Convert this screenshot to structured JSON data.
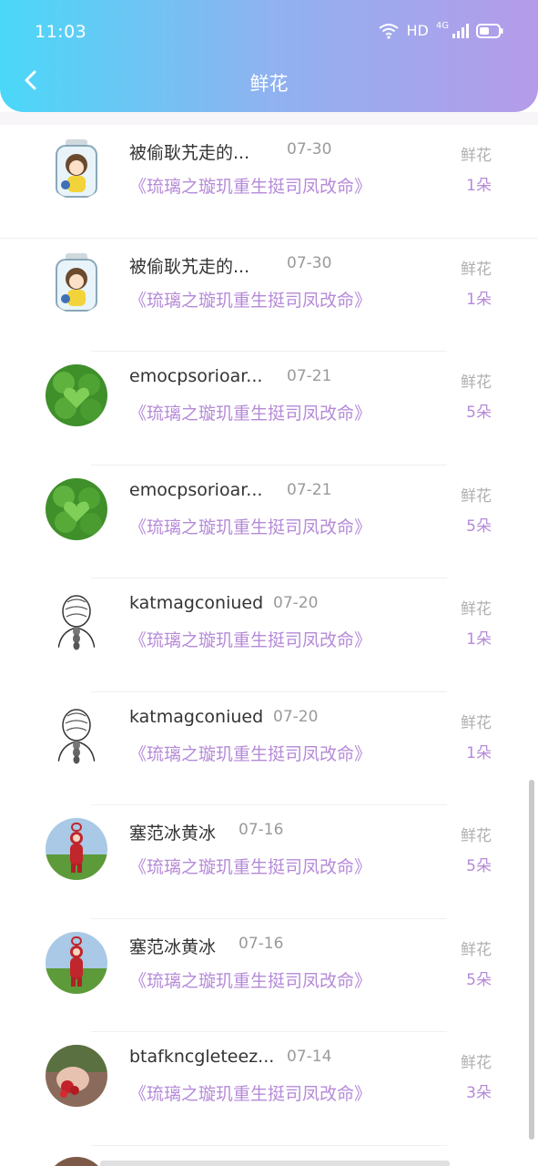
{
  "status_bar": {
    "time": "11:03",
    "hd": "HD",
    "network": "4G"
  },
  "header": {
    "title": "鲜花"
  },
  "records": [
    {
      "name": "被偷耿艽走的...",
      "date": "07-30",
      "book": "《琉璃之璇玑重生挺司凤改命》",
      "type": "鲜花",
      "count": "1朵"
    },
    {
      "name": "被偷耿艽走的...",
      "date": "07-30",
      "book": "《琉璃之璇玑重生挺司凤改命》",
      "type": "鲜花",
      "count": "1朵"
    },
    {
      "name": "emocpsorioar...",
      "date": "07-21",
      "book": "《琉璃之璇玑重生挺司凤改命》",
      "type": "鲜花",
      "count": "5朵"
    },
    {
      "name": "emocpsorioar...",
      "date": "07-21",
      "book": "《琉璃之璇玑重生挺司凤改命》",
      "type": "鲜花",
      "count": "5朵"
    },
    {
      "name": "katmagconiued",
      "date": "07-20",
      "book": "《琉璃之璇玑重生挺司凤改命》",
      "type": "鲜花",
      "count": "1朵"
    },
    {
      "name": "katmagconiued",
      "date": "07-20",
      "book": "《琉璃之璇玑重生挺司凤改命》",
      "type": "鲜花",
      "count": "1朵"
    },
    {
      "name": "塞范冰黄冰",
      "date": "07-16",
      "book": "《琉璃之璇玑重生挺司凤改命》",
      "type": "鲜花",
      "count": "5朵"
    },
    {
      "name": "塞范冰黄冰",
      "date": "07-16",
      "book": "《琉璃之璇玑重生挺司凤改命》",
      "type": "鲜花",
      "count": "5朵"
    },
    {
      "name": "btafkncgleteez...",
      "date": "07-14",
      "book": "《琉璃之璇玑重生挺司凤改命》",
      "type": "鲜花",
      "count": "3朵"
    }
  ]
}
